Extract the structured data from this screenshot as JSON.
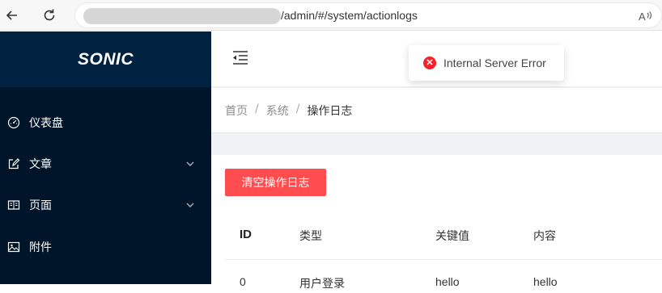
{
  "browser": {
    "url_path": "/admin/#/system/actionlogs",
    "read_aloud_label": "Aͅ"
  },
  "sidebar": {
    "logo": "SONIC",
    "items": [
      {
        "label": "仪表盘",
        "icon": "dashboard-icon",
        "has_submenu": false
      },
      {
        "label": "文章",
        "icon": "edit-icon",
        "has_submenu": true
      },
      {
        "label": "页面",
        "icon": "book-icon",
        "has_submenu": true
      },
      {
        "label": "附件",
        "icon": "picture-icon",
        "has_submenu": false
      }
    ]
  },
  "breadcrumb": {
    "items": [
      "首页",
      "系统",
      "操作日志"
    ],
    "separator": "/"
  },
  "toast": {
    "message": "Internal Server Error",
    "type": "error"
  },
  "actions": {
    "clear_label": "清空操作日志"
  },
  "table": {
    "columns": [
      "ID",
      "类型",
      "关键值",
      "内容"
    ],
    "rows": [
      [
        "0",
        "用户登录",
        "hello",
        "hello"
      ]
    ]
  },
  "colors": {
    "sidebar_bg": "#001529",
    "logo_bg": "#002140",
    "danger": "#ff4d4f",
    "error_icon": "#f5222d"
  }
}
